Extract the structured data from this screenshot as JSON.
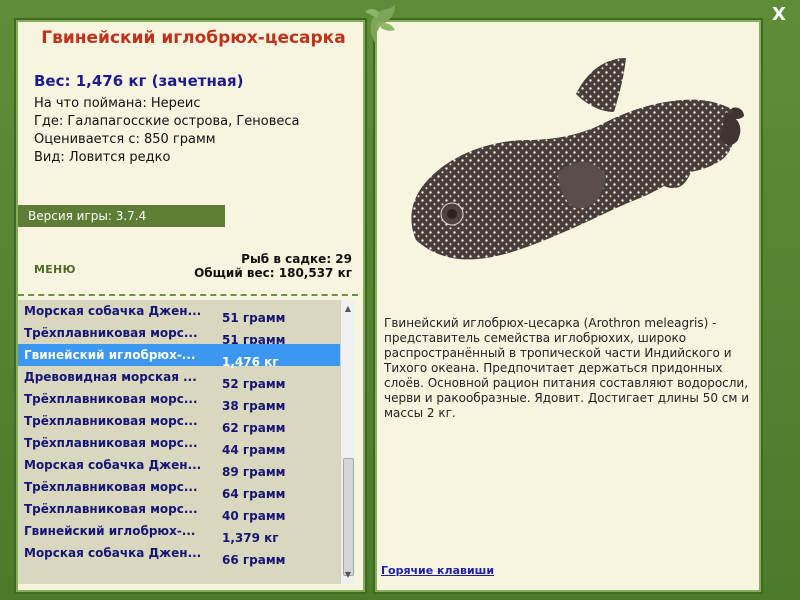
{
  "window": {
    "close_label": "X"
  },
  "fish": {
    "title": "Гвинейский иглобрюх-цесарка",
    "weight": "Вес: 1,476 кг (зачетная)",
    "bait": "На что поймана: Нереис",
    "location": "Где: Галапагосские острова, Геновеса",
    "price": "Оценивается с: 850 грамм",
    "rarity": "Вид: Ловится редко"
  },
  "version": "Версия игры: 3.7.4",
  "menu_label": "МЕНЮ",
  "stats": {
    "fish_in_keepnet": "Рыб в садке: 29",
    "total_weight": "Общий вес: 180,537 кг"
  },
  "catch_list": [
    {
      "name": "Морская собачка Джен...",
      "weight": "51 грамм"
    },
    {
      "name": "Трёхплавниковая морс...",
      "weight": "51 грамм"
    },
    {
      "name": "Гвинейский иглобрюх-...",
      "weight": "1,476 кг",
      "selected": true
    },
    {
      "name": "Древовидная морская ...",
      "weight": "52 грамм"
    },
    {
      "name": "Трёхплавниковая морс...",
      "weight": "38 грамм"
    },
    {
      "name": "Трёхплавниковая морс...",
      "weight": "62 грамм"
    },
    {
      "name": "Трёхплавниковая морс...",
      "weight": "44 грамм"
    },
    {
      "name": "Морская собачка Джен...",
      "weight": "89 грамм"
    },
    {
      "name": "Трёхплавниковая морс...",
      "weight": "64 грамм"
    },
    {
      "name": "Трёхплавниковая морс...",
      "weight": "40 грамм"
    },
    {
      "name": "Гвинейский иглобрюх-...",
      "weight": "1,379 кг"
    },
    {
      "name": "Морская собачка Джен...",
      "weight": "66 грамм"
    }
  ],
  "description": "Гвинейский иглобрюх-цесарка (Arothron meleagris) - представитель семейства иглобрюхих, широко распространённый в тропической части Индийского и Тихого океана. Предпочитает держаться придонных слоёв. Основной рацион питания составляют водоросли, черви и ракообразные. Ядовит. Достигает длины 50 см и массы 2 кг.",
  "hotkeys_label": "Горячие клавиши",
  "colors": {
    "accent": "#c0321b",
    "selected": "#3b97ef",
    "frame": "#4f7a2f"
  }
}
